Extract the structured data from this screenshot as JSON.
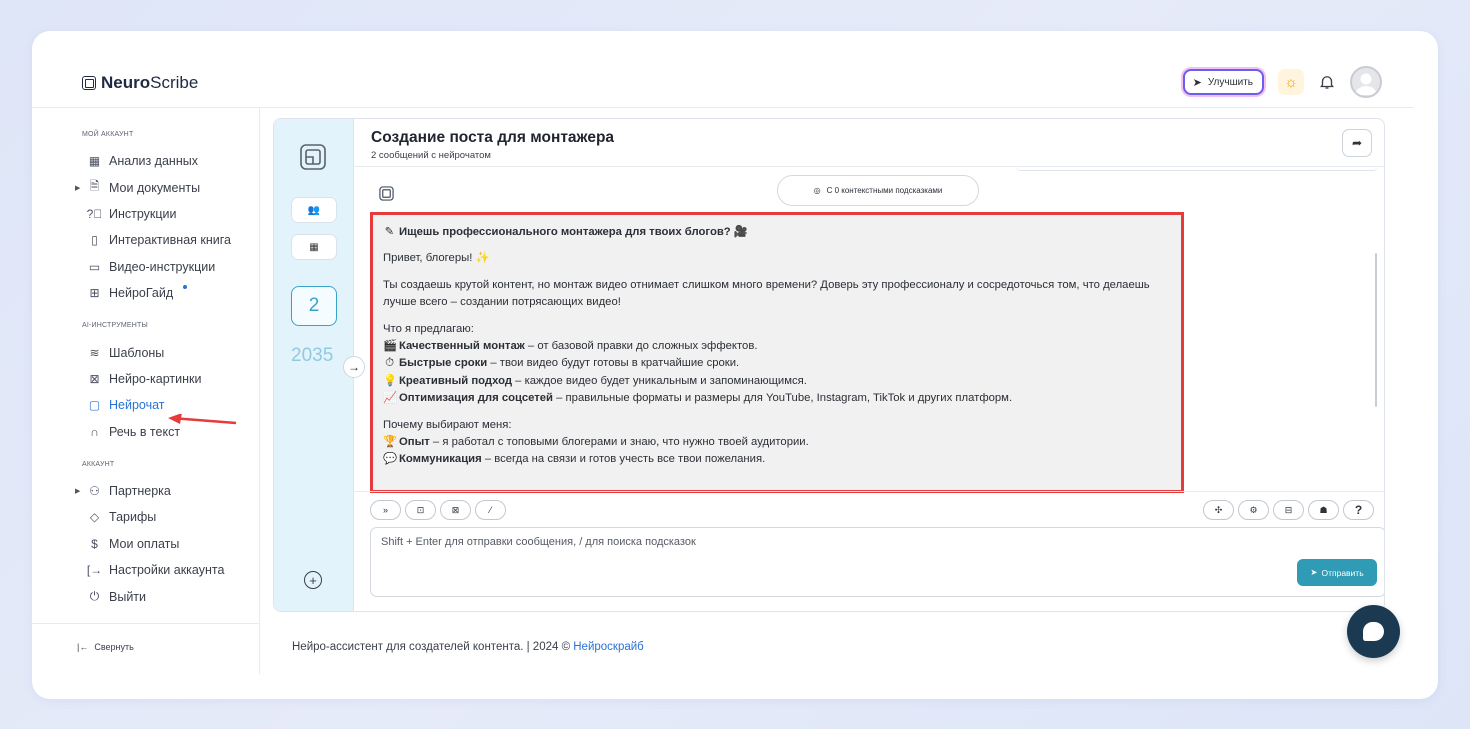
{
  "app": {
    "logo_bold": "Neuro",
    "logo_light": "Scribe"
  },
  "header": {
    "upgrade_label": "Улучшить",
    "icons": [
      "rocket-icon",
      "sun-icon",
      "bell-icon",
      "avatar"
    ]
  },
  "sidebar": {
    "sections": [
      {
        "title": "МОЙ АККАУНТ",
        "items": [
          {
            "label": "Анализ данных",
            "icon": "grid-icon"
          },
          {
            "label": "Мои документы",
            "icon": "document-icon",
            "expandable": true
          },
          {
            "label": "Инструкции",
            "icon": "help-circle-icon"
          },
          {
            "label": "Интерактивная книга",
            "icon": "book-icon"
          },
          {
            "label": "Видео-инструкции",
            "icon": "video-icon"
          },
          {
            "label": "НейроГайд",
            "icon": "table-icon",
            "badge_dot": true
          }
        ]
      },
      {
        "title": "AI-ИНСТРУМЕНТЫ",
        "items": [
          {
            "label": "Шаблоны",
            "icon": "layers-icon"
          },
          {
            "label": "Нейро-картинки",
            "icon": "image-icon"
          },
          {
            "label": "Нейрочат",
            "icon": "chat-icon",
            "active": true
          },
          {
            "label": "Речь в текст",
            "icon": "headphones-icon"
          }
        ]
      },
      {
        "title": "АККАУНТ",
        "items": [
          {
            "label": "Партнерка",
            "icon": "users-icon",
            "expandable": true
          },
          {
            "label": "Тарифы",
            "icon": "tag-icon"
          },
          {
            "label": "Мои оплаты",
            "icon": "dollar-icon"
          },
          {
            "label": "Настройки аккаунта",
            "icon": "login-icon"
          },
          {
            "label": "Выйти",
            "icon": "power-icon"
          }
        ]
      }
    ],
    "collapse_label": "Свернуть"
  },
  "rail": {
    "count": "2",
    "number": "2035"
  },
  "chat": {
    "title": "Создание поста для монтажера",
    "subtitle": "2 сообщений с нейрочатом",
    "context_pill": "С 0 контекстными подсказками",
    "message": {
      "heading": "Ищешь профессионального монтажера для твоих блогов?",
      "greeting": "Привет, блогеры!",
      "intro": "Ты создаешь крутой контент, но монтаж видео отнимает слишком много времени? Доверь эту профессионалу и сосредоточься том, что делаешь лучше всего – создании потрясающих видео!",
      "offer_title": "Что я предлагаю:",
      "offers": [
        {
          "emoji": "🎬",
          "bold": "Качественный монтаж",
          "text": " – от базовой правки до сложных эффектов."
        },
        {
          "emoji": "⏱",
          "bold": "Быстрые сроки",
          "text": " – твои видео будут готовы в кратчайшие сроки."
        },
        {
          "emoji": "💡",
          "bold": "Креативный подход",
          "text": " – каждое видео будет уникальным и запоминающимся."
        },
        {
          "emoji": "📈",
          "bold": "Оптимизация для соцсетей",
          "text": " – правильные форматы и размеры для YouTube, Instagram, TikTok и других платформ."
        }
      ],
      "why_title": "Почему выбирают меня:",
      "reasons": [
        {
          "emoji": "🏆",
          "bold": "Опыт",
          "text": " – я работал с топовыми блогерами и знаю, что нужно твоей аудитории."
        },
        {
          "emoji": "💬",
          "bold": "Коммуникация",
          "text": " – всегда на связи и готов учесть все твои пожелания."
        }
      ]
    },
    "input_placeholder": "Shift + Enter для отправки сообщения, / для поиска подсказок",
    "send_label": "Отправить",
    "help_label": "?"
  },
  "footer": {
    "text": "Нейро-ассистент для создателей контента.  | 2024 © ",
    "link": "Нейроскрайб"
  },
  "colors": {
    "accent": "#2a73d6",
    "send": "#2f9bb4",
    "highlight_border": "#e53b3b",
    "fab": "#1b3a52"
  }
}
